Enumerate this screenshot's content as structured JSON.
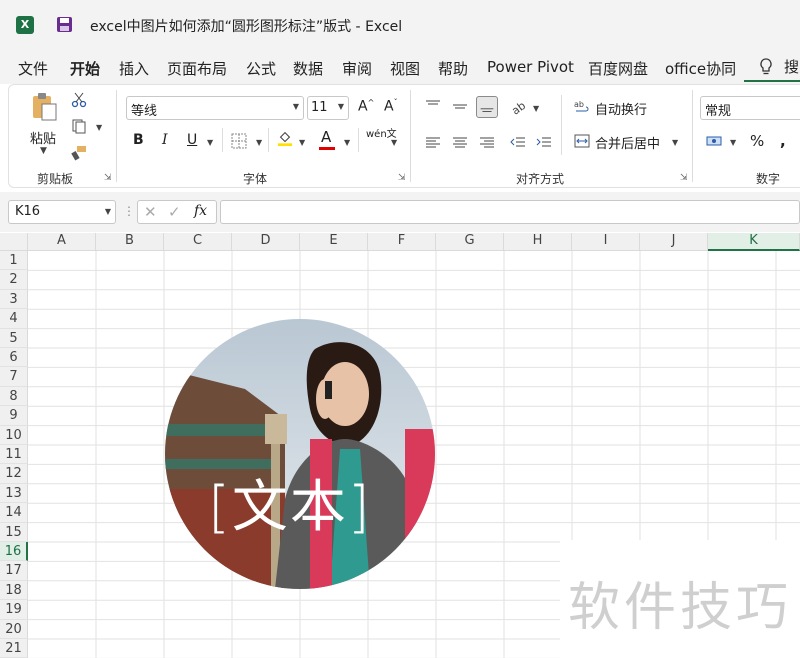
{
  "window": {
    "title": "excel中图片如何添加“圆形图形标注”版式  -  Excel"
  },
  "menu": {
    "tabs": [
      "文件",
      "开始",
      "插入",
      "页面布局",
      "公式",
      "数据",
      "审阅",
      "视图",
      "帮助",
      "Power Pivot",
      "百度网盘",
      "office协同"
    ],
    "active_index": 1,
    "search_partial": "搜"
  },
  "ribbon": {
    "clipboard": {
      "paste_label": "粘贴",
      "group_label": "剪贴板"
    },
    "font": {
      "font_name": "等线",
      "font_size": "11",
      "group_label": "字体",
      "bold": "B",
      "italic": "I",
      "underline": "U",
      "font_color_letter": "A",
      "phonetic": "wén文"
    },
    "alignment": {
      "wrap_text": "自动换行",
      "merge_center": "合并后居中",
      "group_label": "对齐方式"
    },
    "number": {
      "format": "常规",
      "percent": "%",
      "comma": ",",
      "group_label": "数字"
    },
    "colors": {
      "fill_yellow": "#FFE000",
      "font_red": "#E00000",
      "accent": "#217346"
    }
  },
  "formula_bar": {
    "name_box": "K16",
    "fx": "fx",
    "formula": ""
  },
  "sheet": {
    "columns": [
      "A",
      "B",
      "C",
      "D",
      "E",
      "F",
      "G",
      "H",
      "I",
      "J",
      "K"
    ],
    "rows": [
      "1",
      "2",
      "3",
      "4",
      "5",
      "6",
      "7",
      "8",
      "9",
      "10",
      "11",
      "12",
      "13",
      "14",
      "15",
      "16",
      "17",
      "18",
      "19",
      "20",
      "21"
    ],
    "selected_column": "K",
    "selected_row": "16"
  },
  "picture": {
    "annotation_text": "[文本]"
  },
  "watermark": {
    "text": "软件技巧"
  }
}
